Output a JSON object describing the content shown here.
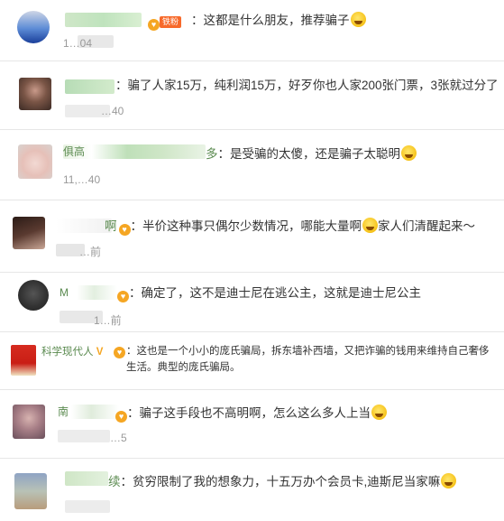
{
  "comments": [
    {
      "name_suffix": "",
      "badge_label": "铁粉",
      "text": "这都是什么朋友，推荐骗子",
      "meta": "1…04"
    },
    {
      "name_suffix": "",
      "text": "骗了人家15万，纯利润15万，好歹你也人家200张门票，3张就过分了",
      "meta": "…40"
    },
    {
      "name_prefix": "俱高",
      "name_suffix": "多",
      "text": "是受骗的太傻，还是骗子太聪明",
      "meta": "11,…40"
    },
    {
      "name_suffix": "啊",
      "text": "半价这种事只偶尔少数情况，哪能大量啊",
      "text_tail": "家人们清醒起来～",
      "meta": "…前"
    },
    {
      "name_prefix": "M",
      "name_suffix": "",
      "text": "确定了，这不是迪士尼在逃公主，这就是迪士尼公主",
      "meta": "1…前"
    },
    {
      "name": "科学现代人",
      "text": "这也是一个小小的庞氏骗局，拆东墙补西墙，又把诈骗的钱用来维持自己奢侈生活。典型的庞氏骗局。"
    },
    {
      "name_prefix": "南",
      "name_suffix": "",
      "text": "骗子这手段也不高明啊，怎么这么多人上当",
      "meta": "…5"
    },
    {
      "name_suffix": "续",
      "text": "贫穷限制了我的想象力，十五万办个会员卡,迪斯尼当家嘛",
      "meta": ""
    }
  ]
}
